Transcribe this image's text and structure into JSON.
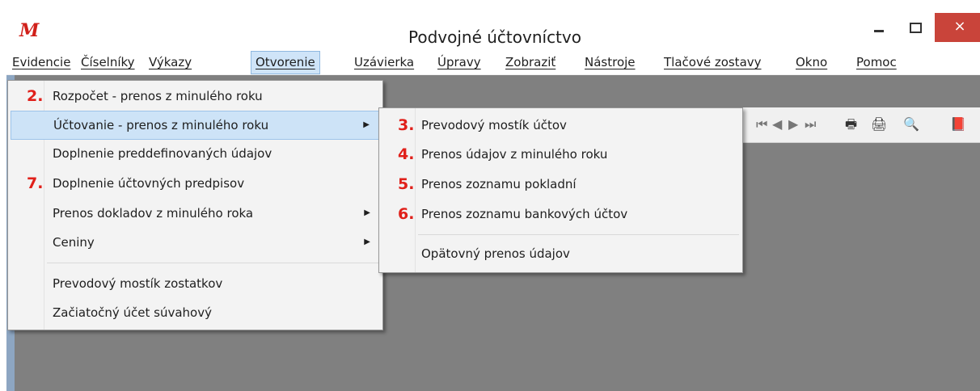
{
  "window": {
    "logo": "M",
    "title": "Podvojné účtovníctvo",
    "close_glyph": "×"
  },
  "menubar": [
    {
      "label": "Evidencie",
      "active": false
    },
    {
      "label": "Číselníky",
      "active": false
    },
    {
      "label": "Výkazy",
      "active": false
    },
    {
      "label": "Otvorenie",
      "active": true
    },
    {
      "label": "Uzávierka",
      "active": false
    },
    {
      "label": "Úpravy",
      "active": false
    },
    {
      "label": "Zobraziť",
      "active": false
    },
    {
      "label": "Nástroje",
      "active": false
    },
    {
      "label": "Tlačové zostavy",
      "active": false
    },
    {
      "label": "Okno",
      "active": false
    },
    {
      "label": "Pomoc",
      "active": false
    }
  ],
  "dropdown": {
    "items": [
      {
        "number": "2.",
        "label": "Rozpočet - prenos z minulého roku"
      },
      {
        "number": "",
        "label": "Účtovanie - prenos z minulého roku",
        "submenu": true,
        "highlighted": true
      },
      {
        "number": "",
        "label": "Doplnenie preddefinovaných údajov"
      },
      {
        "number": "7.",
        "label": "Doplnenie účtovných predpisov"
      },
      {
        "number": "",
        "label": "Prenos dokladov z minulého roka",
        "submenu": true
      },
      {
        "number": "",
        "label": "Ceniny",
        "submenu": true
      },
      {
        "number": "",
        "label": "Prevodový mostík zostatkov"
      },
      {
        "number": "",
        "label": "Začiatočný účet súvahový"
      }
    ],
    "submenu_arrow": "▶"
  },
  "submenu": {
    "items": [
      {
        "number": "3.",
        "label": "Prevodový mostík účtov"
      },
      {
        "number": "4.",
        "label": "Prenos údajov z minulého roku"
      },
      {
        "number": "5.",
        "label": "Prenos zoznamu pokladní"
      },
      {
        "number": "6.",
        "label": "Prenos zoznamu bankových účtov"
      },
      {
        "number": "",
        "label": "Opätovný prenos údajov"
      }
    ]
  },
  "toolbar": {
    "icons": [
      "first-record-icon",
      "previous-record-icon",
      "next-record-icon",
      "last-record-icon",
      "print-preview-icon",
      "print-icon",
      "find-icon",
      "help-book-icon"
    ],
    "glyphs": [
      "⏮",
      "◀",
      "▶",
      "⏭",
      "🖶",
      "🖨",
      "🔍",
      "📕"
    ]
  },
  "colors": {
    "accent_number": "#e0201a",
    "highlight": "#cde3f7",
    "workspace": "#808080",
    "close_button": "#c9443a"
  }
}
